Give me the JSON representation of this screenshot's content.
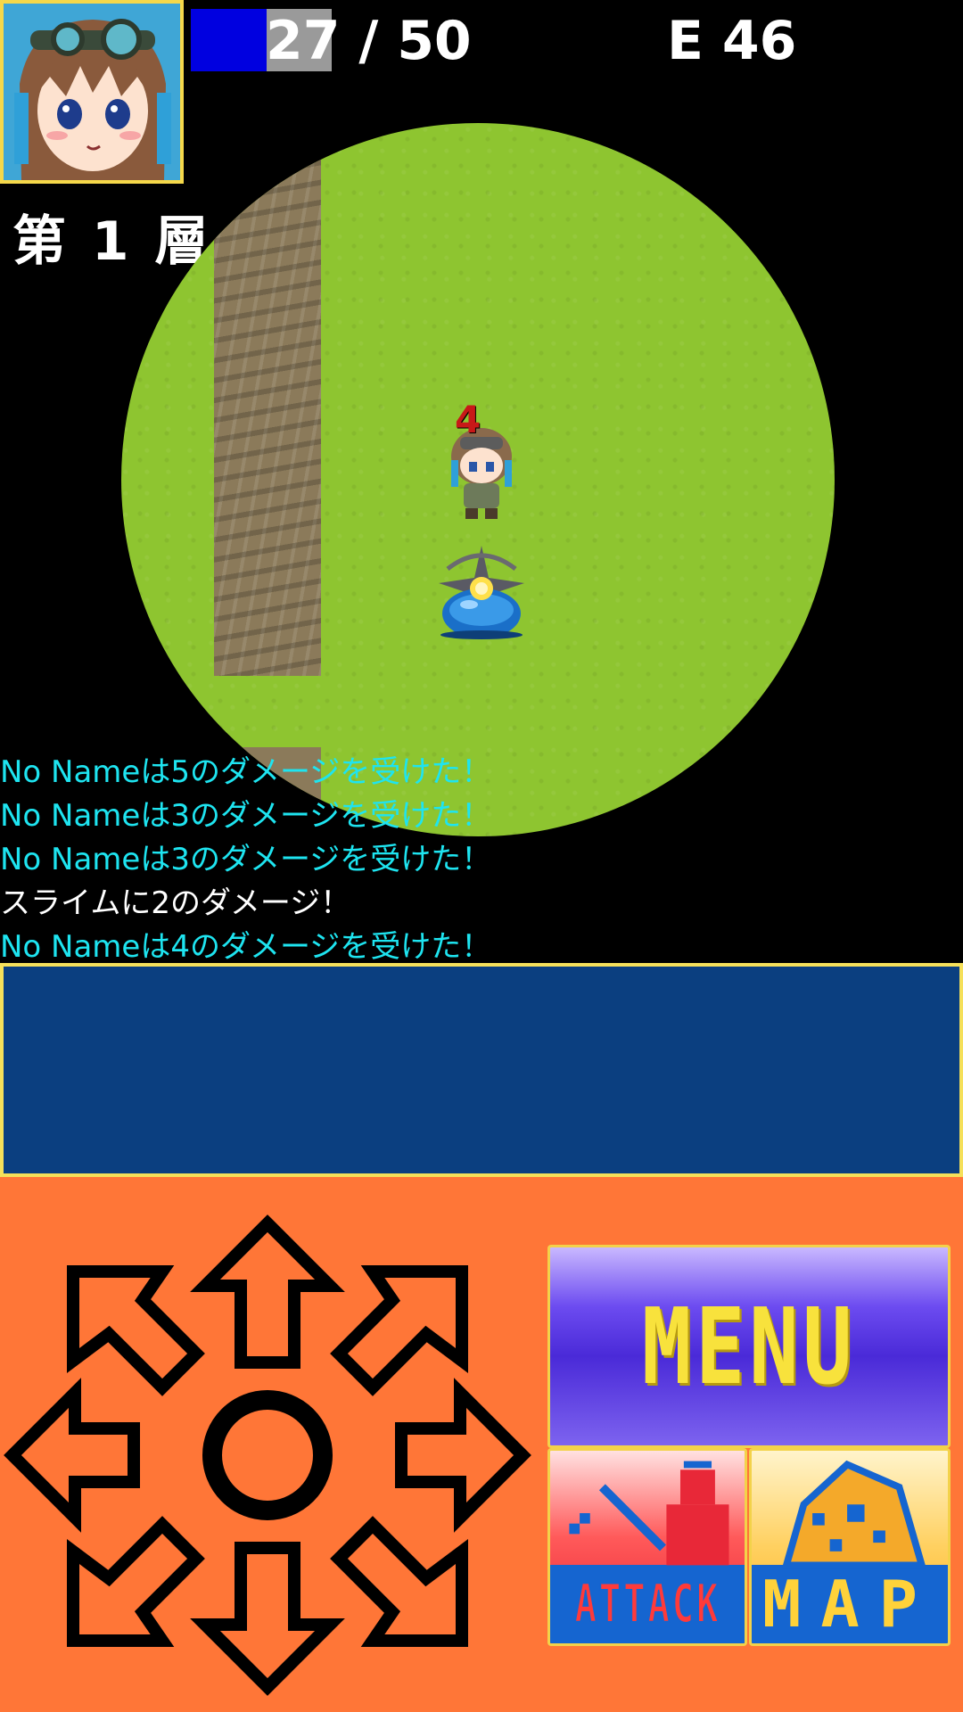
{
  "hud": {
    "hp_current": 27,
    "hp_max": 50,
    "hp_text": "27 / 50",
    "hp_fraction": 0.54,
    "exp_text": "E 46",
    "floor_text": "第 1 層",
    "hp_bar_color": "#0000e0"
  },
  "map": {
    "damage_popup": "4",
    "grass_color": "#8ec530",
    "wall_color": "#8b7a5a"
  },
  "battle_log": [
    {
      "text": "No Nameは5のダメージを受けた！",
      "color": "cyan"
    },
    {
      "text": "No Nameは3のダメージを受けた！",
      "color": "cyan"
    },
    {
      "text": "No Nameは3のダメージを受けた！",
      "color": "cyan"
    },
    {
      "text": "スライムに2のダメージ！",
      "color": "white"
    },
    {
      "text": "No Nameは4のダメージを受けた！",
      "color": "cyan"
    }
  ],
  "controls": {
    "menu_label": "MENU",
    "attack_label": "ATTACK",
    "map_label": "MAP",
    "panel_color": "#ff7637"
  },
  "icons": {
    "dpad": "dpad-icon",
    "center": "wait-circle-icon",
    "attack": "sword-attack-icon",
    "map": "map-scroll-icon"
  }
}
